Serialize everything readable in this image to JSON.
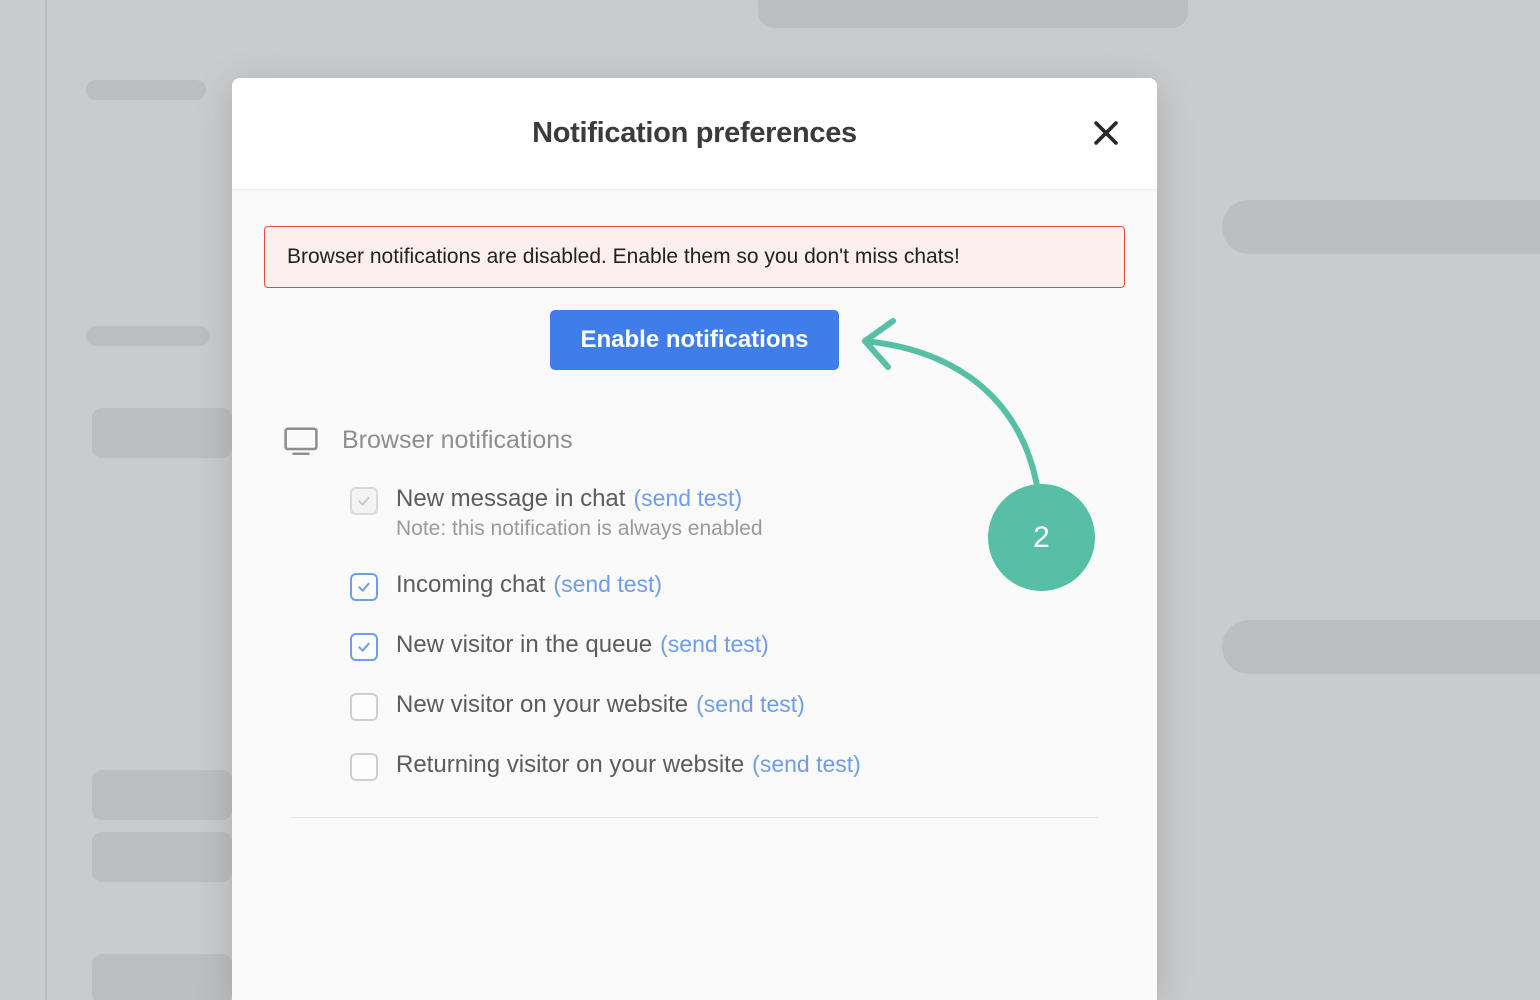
{
  "modal": {
    "title": "Notification preferences",
    "alert": "Browser notifications are disabled. Enable them so you don't miss chats!",
    "enable_button": "Enable notifications",
    "section_title": "Browser notifications",
    "send_test_label": "(send test)",
    "options": [
      {
        "label": "New message in chat",
        "note": "Note: this notification is always enabled",
        "checked": true,
        "disabled": true
      },
      {
        "label": "Incoming chat",
        "note": "",
        "checked": true,
        "disabled": false
      },
      {
        "label": "New visitor in the queue",
        "note": "",
        "checked": true,
        "disabled": false
      },
      {
        "label": "New visitor on your website",
        "note": "",
        "checked": false,
        "disabled": false
      },
      {
        "label": "Returning visitor on your website",
        "note": "",
        "checked": false,
        "disabled": false
      }
    ]
  },
  "annotation": {
    "step_number": "2"
  }
}
